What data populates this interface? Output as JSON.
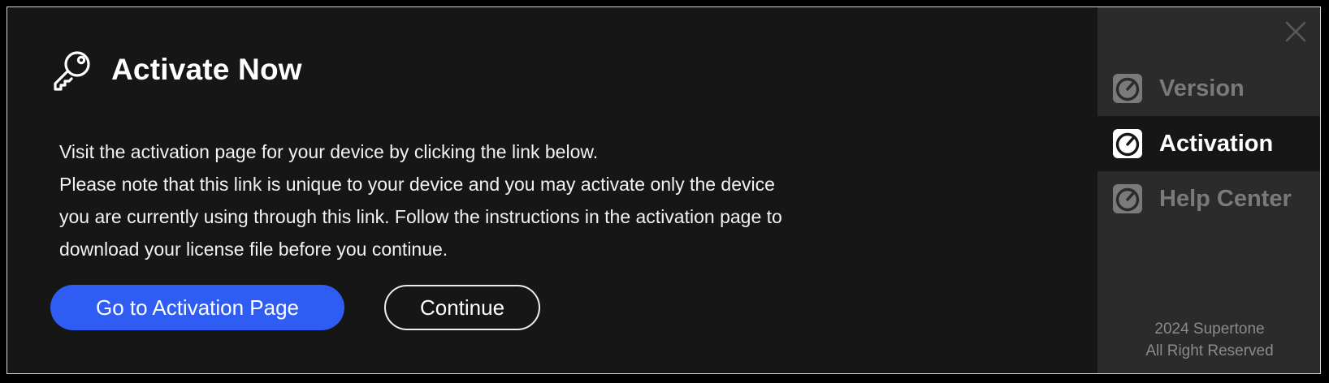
{
  "header": {
    "icon": "key-icon",
    "title": "Activate Now"
  },
  "body": {
    "lines": [
      "Visit the activation page for your device by clicking the link below.",
      "Please note that this link is unique to your device and you may activate only the device",
      "you are currently using through this link. Follow the instructions in the activation page to",
      "download your license file before you continue."
    ]
  },
  "buttons": {
    "primary_label": "Go to Activation Page",
    "secondary_label": "Continue"
  },
  "sidebar": {
    "close_icon": "close-icon",
    "items": [
      {
        "label": "Version",
        "icon": "gauge-icon",
        "active": false
      },
      {
        "label": "Activation",
        "icon": "gauge-icon",
        "active": true
      },
      {
        "label": "Help Center",
        "icon": "gauge-icon",
        "active": false
      }
    ],
    "footer": {
      "line1": "2024 Supertone",
      "line2": "All Right Reserved"
    }
  },
  "colors": {
    "background": "#161616",
    "sidebar": "#2b2b2b",
    "accent": "#2f5cf2",
    "text": "#ffffff",
    "muted": "#7a7a7a"
  }
}
